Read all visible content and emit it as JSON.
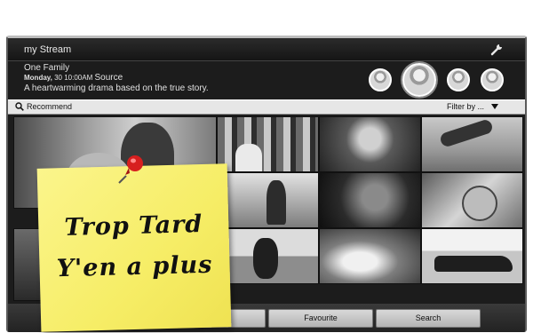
{
  "header": {
    "app_title": "my Stream"
  },
  "program": {
    "name": "One Family",
    "day": "Monday,",
    "time": "30 10:00AM",
    "source": "Source",
    "description": "A heartwarming drama based on the true story."
  },
  "filter_bar": {
    "recommend_label": "Recommend",
    "filter_label": "Filter by ..."
  },
  "bottom_bar": {
    "favourite_label": "Favourite",
    "search_label": "Search"
  },
  "note": {
    "line1": "Trop Tard",
    "line2": "Y'en a plus"
  },
  "icons": {
    "settings": "wrench-icon",
    "search": "search-icon",
    "pin": "push-pin-icon"
  },
  "colors": {
    "screen_bg": "#1c1c1c",
    "note_yellow": "#f6ed66",
    "pin_red": "#d71f1f"
  }
}
